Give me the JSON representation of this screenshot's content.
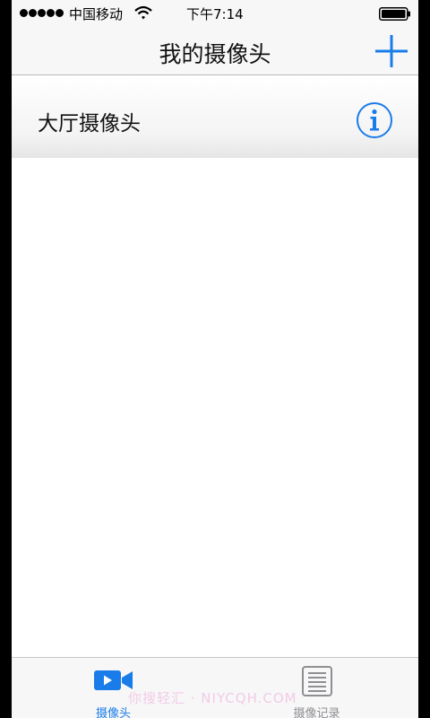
{
  "status_bar": {
    "carrier": "中国移动",
    "time": "下午7:14"
  },
  "nav": {
    "title": "我的摄像头",
    "add_icon": "plus-icon"
  },
  "cameras": [
    {
      "label": "大厅摄像头",
      "info_icon": "info-icon"
    }
  ],
  "tabs": [
    {
      "label": "摄像头",
      "icon": "video-camera-icon",
      "selected": true
    },
    {
      "label": "摄像记录",
      "icon": "list-icon",
      "selected": false
    }
  ],
  "watermark": "你搜轻汇 · NIYCQH.COM",
  "colors": {
    "accent": "#1a7ce8",
    "inactive_tab": "#8e8e93",
    "bar_background": "#f7f7f7"
  }
}
